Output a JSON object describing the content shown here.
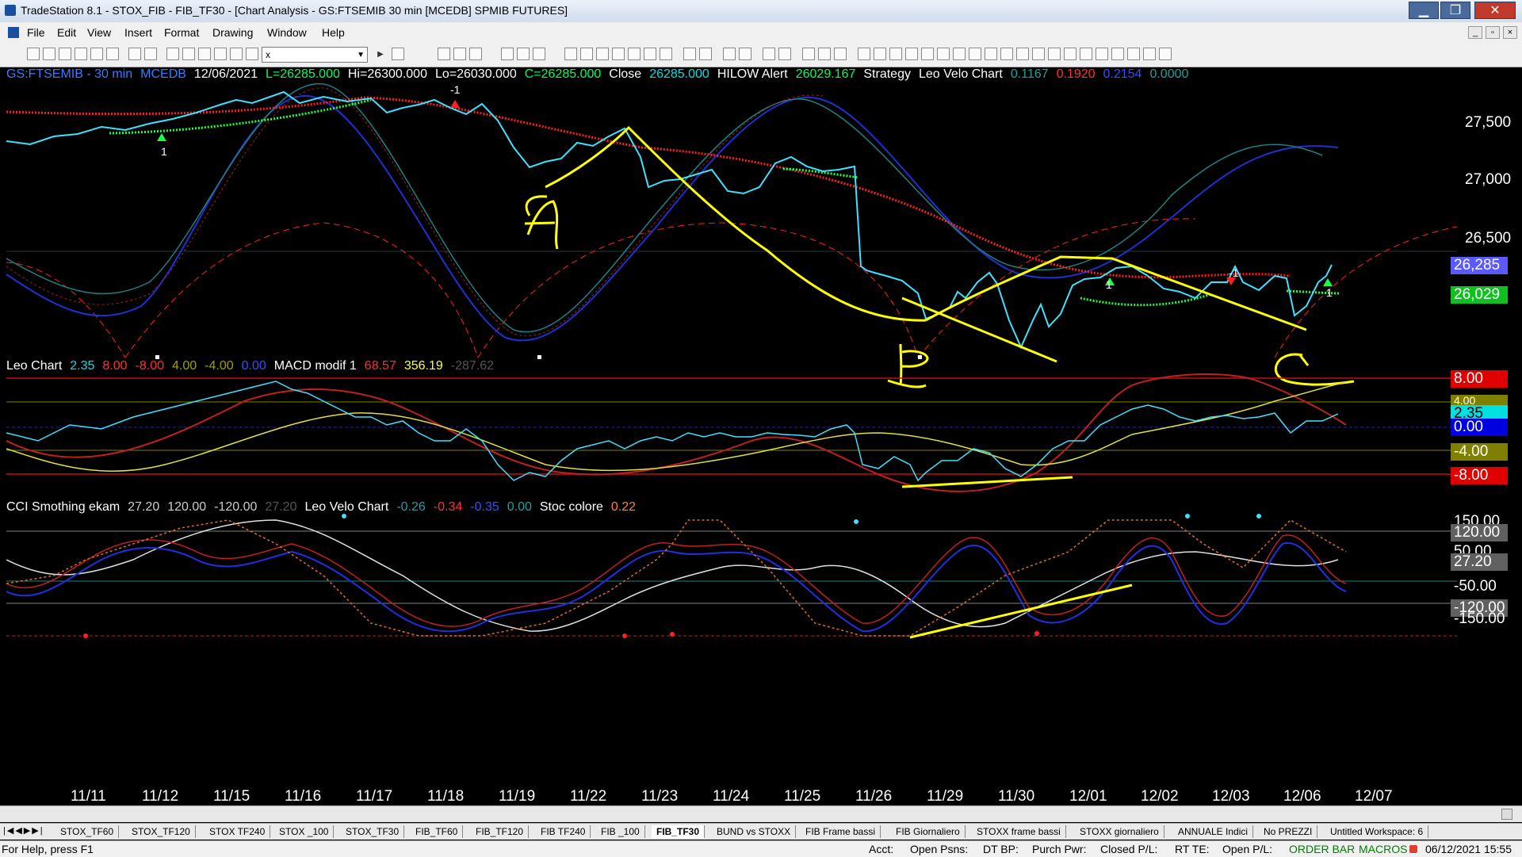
{
  "window": {
    "title": "TradeStation 8.1 - STOX_FIB - FIB_TF30 - [Chart Analysis - GS:FTSEMIB  30 min  [MCEDB] SPMIB FUTURES]",
    "minimize": "▁",
    "maximize": "❐",
    "close": "✕"
  },
  "menu": [
    "File",
    "Edit",
    "View",
    "Insert",
    "Format",
    "Drawing",
    "Window",
    "Help"
  ],
  "toolbar": {
    "combo_value": "x"
  },
  "chart": {
    "info_main": [
      {
        "text": "GS:FTSEMIB - 30 min",
        "color": "#3a7bff"
      },
      {
        "text": "MCEDB",
        "color": "#3a7bff"
      },
      {
        "text": "12/06/2021",
        "color": "#ffffff"
      },
      {
        "text": "L=26285.000",
        "color": "#00ff60"
      },
      {
        "text": "Hi=26300.000",
        "color": "#ffffff"
      },
      {
        "text": "Lo=26030.000",
        "color": "#ffffff"
      },
      {
        "text": "C=26285.000",
        "color": "#00ff60"
      },
      {
        "text": "Close",
        "color": "#ffffff"
      },
      {
        "text": "26285.000",
        "color": "#00e0e0"
      },
      {
        "text": "HILOW Alert",
        "color": "#ffffff"
      },
      {
        "text": "26029.167",
        "color": "#00ff60"
      },
      {
        "text": "Strategy",
        "color": "#ffffff"
      },
      {
        "text": "Leo Velo Chart",
        "color": "#ffffff"
      },
      {
        "text": "0.1167",
        "color": "#20a0a0"
      },
      {
        "text": "0.1920",
        "color": "#ff3030"
      },
      {
        "text": "0.2154",
        "color": "#3050ff"
      },
      {
        "text": "0.0000",
        "color": "#20a0a0"
      }
    ],
    "info_macd": [
      {
        "text": "Leo Chart",
        "color": "#ffffff"
      },
      {
        "text": "2.35",
        "color": "#00e0e0"
      },
      {
        "text": "8.00",
        "color": "#ff3030"
      },
      {
        "text": "-8.00",
        "color": "#ff3030"
      },
      {
        "text": "4.00",
        "color": "#a0a000"
      },
      {
        "text": "-4.00",
        "color": "#a0a000"
      },
      {
        "text": "0.00",
        "color": "#3050ff"
      },
      {
        "text": "MACD modif 1",
        "color": "#ffffff"
      },
      {
        "text": "68.57",
        "color": "#ff3030"
      },
      {
        "text": "356.19",
        "color": "#ffff40"
      },
      {
        "text": "-287.62",
        "color": "#555555"
      }
    ],
    "info_cci": [
      {
        "text": "CCI Smothing ekam",
        "color": "#ffffff"
      },
      {
        "text": "27.20",
        "color": "#cccccc"
      },
      {
        "text": "120.00",
        "color": "#cccccc"
      },
      {
        "text": "-120.00",
        "color": "#cccccc"
      },
      {
        "text": "27.20",
        "color": "#555555"
      },
      {
        "text": "Leo Velo Chart",
        "color": "#ffffff"
      },
      {
        "text": "-0.26",
        "color": "#20a0a0"
      },
      {
        "text": "-0.34",
        "color": "#ff3030"
      },
      {
        "text": "-0.35",
        "color": "#3050ff"
      },
      {
        "text": "0.00",
        "color": "#20a0a0"
      },
      {
        "text": "Stoc colore",
        "color": "#ffffff"
      },
      {
        "text": "0.22",
        "color": "#ff8030"
      }
    ],
    "price_axis": [
      "27,500",
      "27,000",
      "26,500"
    ],
    "price_boxes": [
      {
        "text": "26,285",
        "bg": "#5a5aff",
        "fg": "#ffffff"
      },
      {
        "text": "26,029",
        "bg": "#10c020",
        "fg": "#ffffff"
      }
    ],
    "macd_axis": [
      {
        "text": "8.00",
        "bg": "#e00000",
        "fg": "#ffffff"
      },
      {
        "text": "4.00",
        "bg": "#808000",
        "fg": "#ffffff"
      },
      {
        "text": "2.35",
        "bg": "#00e0e0",
        "fg": "#000000"
      },
      {
        "text": "0.00",
        "bg": "#0000e0",
        "fg": "#ffffff"
      },
      {
        "text": "-4.00",
        "bg": "#808000",
        "fg": "#ffffff"
      },
      {
        "text": "-8.00",
        "bg": "#e00000",
        "fg": "#ffffff"
      }
    ],
    "cci_axis": [
      {
        "text": "150.00",
        "bg": "transparent",
        "fg": "#ffffff"
      },
      {
        "text": "120.00",
        "bg": "#606060",
        "fg": "#ffffff"
      },
      {
        "text": "50.00",
        "bg": "transparent",
        "fg": "#ffffff"
      },
      {
        "text": "27.20",
        "bg": "#606060",
        "fg": "#ffffff"
      },
      {
        "text": "-50.00",
        "bg": "transparent",
        "fg": "#ffffff"
      },
      {
        "text": "-120.00",
        "bg": "#606060",
        "fg": "#ffffff"
      },
      {
        "text": "-150.00",
        "bg": "transparent",
        "fg": "#ffffff"
      }
    ],
    "dates": [
      "11/11",
      "11/12",
      "11/15",
      "11/16",
      "11/17",
      "11/18",
      "11/19",
      "11/22",
      "11/23",
      "11/24",
      "11/25",
      "11/26",
      "11/29",
      "11/30",
      "12/01",
      "12/02",
      "12/03",
      "12/06",
      "12/07"
    ],
    "annotations": [
      "A",
      "B",
      "C"
    ],
    "markers": [
      "-1",
      "1",
      "-1",
      "1",
      "1"
    ]
  },
  "tabs": [
    "STOX_TF60",
    "STOX_TF120",
    "STOX TF240",
    "STOX _100",
    "STOX_TF30",
    "FIB_TF60",
    "FIB_TF120",
    "FIB TF240",
    "FIB _100",
    "FIB_TF30",
    "BUND vs STOXX",
    "FIB Frame bassi",
    "FIB Giornaliero",
    "STOXX frame bassi",
    "STOXX giornaliero",
    "ANNUALE Indici",
    "No PREZZI",
    "Untitled Workspace: 6"
  ],
  "active_tab": "FIB_TF30",
  "status": {
    "help": "For Help, press F1",
    "acct": "Acct:",
    "open_psns": "Open Psns:",
    "dt_bp": "DT BP:",
    "purch_pwr": "Purch Pwr:",
    "closed_pl": "Closed P/L:",
    "rt_te": "RT TE:",
    "open_pl": "Open P/L:",
    "order_bar": "ORDER BAR",
    "macros": "MACROS",
    "datetime": "06/12/2021 15:55"
  },
  "colors": {
    "price_line": "#40e0ff",
    "red_ma": "#ff2020",
    "green_ma": "#20ff40",
    "blue_osc": "#2020ff",
    "yellow_draw": "#ffff00"
  }
}
